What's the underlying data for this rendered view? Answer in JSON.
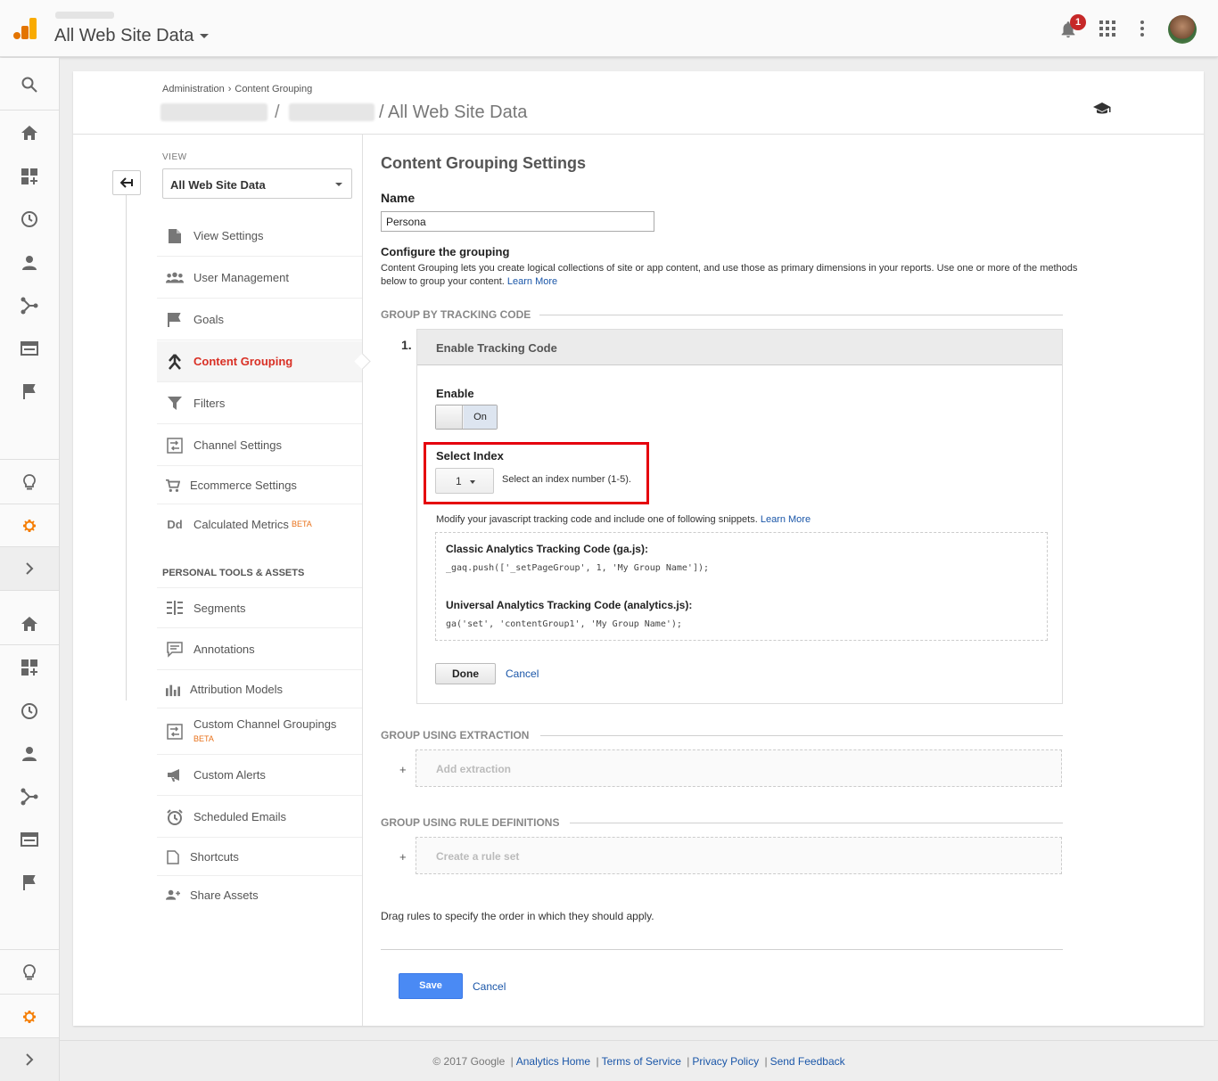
{
  "topbar": {
    "title": "All Web Site Data",
    "notification_count": "1",
    "icons": [
      "analytics-logo-icon",
      "bell-icon",
      "apps-grid-icon",
      "more-vert-icon",
      "avatar"
    ]
  },
  "rail": {
    "items": [
      "search-icon",
      "home-icon",
      "dashboard-icon",
      "clock-icon",
      "person-icon",
      "acquisition-icon",
      "behavior-icon",
      "flag-icon",
      "lightbulb-icon",
      "gear-icon",
      "chevron-right-icon",
      "home-icon",
      "dashboard-icon",
      "clock-icon",
      "person-icon",
      "acquisition-icon",
      "behavior-icon",
      "flag-icon",
      "lightbulb-icon",
      "gear-icon",
      "chevron-right-icon"
    ],
    "accent": "#f57c00"
  },
  "breadcrumb": {
    "admin": "Administration",
    "sep": "›",
    "current": "Content Grouping"
  },
  "path": {
    "slash": "/",
    "current": "/ All Web Site Data"
  },
  "nav": {
    "view_label": "VIEW",
    "view_value": "All Web Site Data",
    "items": [
      {
        "label": "View Settings",
        "icon": "document-icon"
      },
      {
        "label": "User Management",
        "icon": "people-icon"
      },
      {
        "label": "Goals",
        "icon": "flag-icon"
      },
      {
        "label": "Content Grouping",
        "icon": "content-grouping-icon"
      },
      {
        "label": "Filters",
        "icon": "filter-icon"
      },
      {
        "label": "Channel Settings",
        "icon": "channel-settings-icon"
      },
      {
        "label": "Ecommerce Settings",
        "icon": "cart-icon"
      },
      {
        "label": "Calculated Metrics",
        "icon": "dd-icon",
        "badge": "BETA"
      }
    ],
    "section_label": "PERSONAL TOOLS & ASSETS",
    "tools": [
      {
        "label": "Segments",
        "icon": "segments-icon"
      },
      {
        "label": "Annotations",
        "icon": "annotation-icon"
      },
      {
        "label": "Attribution Models",
        "icon": "bar-chart-icon"
      },
      {
        "label": "Custom Channel Groupings",
        "icon": "channel-settings-icon",
        "badge": "BETA"
      },
      {
        "label": "Custom Alerts",
        "icon": "megaphone-icon"
      },
      {
        "label": "Scheduled Emails",
        "icon": "alarm-clock-icon"
      },
      {
        "label": "Shortcuts",
        "icon": "document-icon"
      },
      {
        "label": "Share Assets",
        "icon": "person-add-icon"
      }
    ],
    "dd_text": "Dd"
  },
  "main": {
    "heading": "Content Grouping Settings",
    "name_label": "Name",
    "name_value": "Persona",
    "configure_heading": "Configure the grouping",
    "configure_desc": "Content Grouping lets you create logical collections of site or app content, and use those as primary dimensions in your reports. Use one or more of the methods below to group your content.",
    "learn_more": "Learn More",
    "section_tracking": "GROUP BY TRACKING CODE",
    "step_number": "1.",
    "tracking_box_title": "Enable Tracking Code",
    "enable_label": "Enable",
    "toggle_state": "On",
    "select_index_label": "Select Index",
    "index_value": "1",
    "index_hint": "Select an index number (1-5).",
    "modify_text": "Modify your javascript tracking code and include one of following snippets.",
    "modify_link": "Learn More",
    "classic_heading": "Classic Analytics Tracking Code (ga.js):",
    "classic_code": "_gaq.push(['_setPageGroup', 1, 'My Group Name']);",
    "universal_heading": "Universal Analytics Tracking Code (analytics.js):",
    "universal_code": "ga('set', 'contentGroup1', 'My Group Name');",
    "done_label": "Done",
    "cancel_label": "Cancel",
    "section_extraction": "GROUP USING EXTRACTION",
    "add_extraction": "Add extraction",
    "section_rules": "GROUP USING RULE DEFINITIONS",
    "create_rule_set": "Create a rule set",
    "plus": "+",
    "drag_note": "Drag rules to specify the order in which they should apply.",
    "save_label": "Save",
    "save_cancel_label": "Cancel",
    "highlight_color": "#e5000d",
    "primary_color": "#4a8af4"
  },
  "footer": {
    "copyright": "© 2017 Google",
    "links": [
      "Analytics Home",
      "Terms of Service",
      "Privacy Policy",
      "Send Feedback"
    ],
    "sep": "|"
  }
}
